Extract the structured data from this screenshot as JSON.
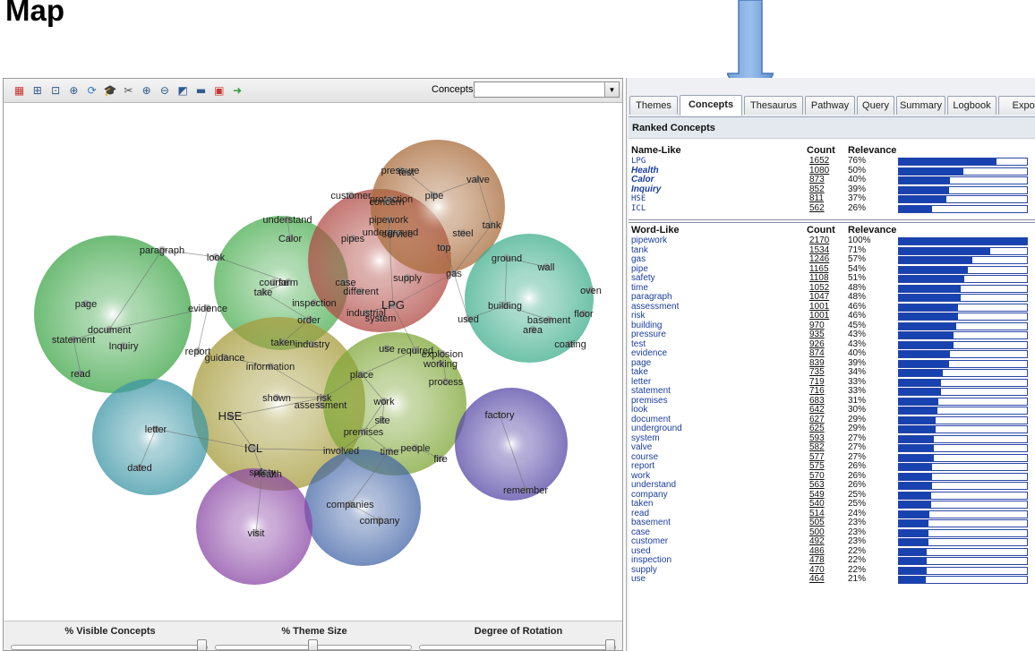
{
  "heading": "Map",
  "toolbar": {
    "icons": [
      "leximancer-logo-icon",
      "fit-icon",
      "center-icon",
      "expand-icon",
      "refresh-icon",
      "graduation-cap-icon",
      "scissors-icon",
      "zoom-in-icon",
      "zoom-out-icon",
      "chart-icon",
      "image-icon",
      "save-icon",
      "go-arrow-icon"
    ],
    "concepts_label": "Concepts:",
    "concepts_value": ""
  },
  "themes": [
    {
      "id": "document",
      "color": "#3fa649"
    },
    {
      "id": "understand",
      "color": "#4cae52"
    },
    {
      "id": "pipework",
      "color": "#b04a44"
    },
    {
      "id": "pressure",
      "color": "#a96b3a"
    },
    {
      "id": "building",
      "color": "#3fae8c"
    },
    {
      "id": "HSE",
      "color": "#a59b3a"
    },
    {
      "id": "letter",
      "color": "#3c96a6"
    },
    {
      "id": "work",
      "color": "#7ea636"
    },
    {
      "id": "factory",
      "color": "#5648a6"
    },
    {
      "id": "companies",
      "color": "#4567a8"
    },
    {
      "id": "visit",
      "color": "#8b48a6"
    }
  ],
  "map_labels": [
    {
      "text": "pressure"
    },
    {
      "text": "test"
    },
    {
      "text": "valve"
    },
    {
      "text": "customer"
    },
    {
      "text": "protection"
    },
    {
      "text": "concern"
    },
    {
      "text": "pipe"
    },
    {
      "text": "understand"
    },
    {
      "text": "pipework"
    },
    {
      "text": "Calor"
    },
    {
      "text": "pipes"
    },
    {
      "text": "underground"
    },
    {
      "text": "service"
    },
    {
      "text": "tank"
    },
    {
      "text": "steel"
    },
    {
      "text": "top"
    },
    {
      "text": "paragraph"
    },
    {
      "text": "look"
    },
    {
      "text": "ground"
    },
    {
      "text": "wall"
    },
    {
      "text": "gas"
    },
    {
      "text": "supply"
    },
    {
      "text": "course"
    },
    {
      "text": "form"
    },
    {
      "text": "case"
    },
    {
      "text": "different"
    },
    {
      "text": "take"
    },
    {
      "text": "oven"
    },
    {
      "text": "page"
    },
    {
      "text": "evidence"
    },
    {
      "text": "inspection"
    },
    {
      "text": "LPG"
    },
    {
      "text": "building"
    },
    {
      "text": "industrial"
    },
    {
      "text": "system"
    },
    {
      "text": "floor"
    },
    {
      "text": "order"
    },
    {
      "text": "used"
    },
    {
      "text": "basement"
    },
    {
      "text": "area"
    },
    {
      "text": "document"
    },
    {
      "text": "statement"
    },
    {
      "text": "Inquiry"
    },
    {
      "text": "taken"
    },
    {
      "text": "industry"
    },
    {
      "text": "coating"
    },
    {
      "text": "report"
    },
    {
      "text": "guidance"
    },
    {
      "text": "use"
    },
    {
      "text": "required"
    },
    {
      "text": "explosion"
    },
    {
      "text": "information"
    },
    {
      "text": "working"
    },
    {
      "text": "read"
    },
    {
      "text": "place"
    },
    {
      "text": "process"
    },
    {
      "text": "risk"
    },
    {
      "text": "shown"
    },
    {
      "text": "assessment"
    },
    {
      "text": "work"
    },
    {
      "text": "HSE"
    },
    {
      "text": "factory"
    },
    {
      "text": "letter"
    },
    {
      "text": "site"
    },
    {
      "text": "premises"
    },
    {
      "text": "ICL"
    },
    {
      "text": "involved"
    },
    {
      "text": "time"
    },
    {
      "text": "people"
    },
    {
      "text": "fire"
    },
    {
      "text": "dated"
    },
    {
      "text": "safety"
    },
    {
      "text": "Health"
    },
    {
      "text": "remember"
    },
    {
      "text": "companies"
    },
    {
      "text": "company"
    },
    {
      "text": "visit"
    }
  ],
  "sliders": [
    {
      "label": "% Visible Concepts",
      "value": 1.0
    },
    {
      "label": "% Theme Size",
      "value": 0.5
    },
    {
      "label": "Degree of Rotation",
      "value": 1.0
    }
  ],
  "tabs": [
    {
      "label": "Themes",
      "active": false
    },
    {
      "label": "Concepts",
      "active": true
    },
    {
      "label": "Thesaurus",
      "active": false
    },
    {
      "label": "Pathway",
      "active": false
    },
    {
      "label": "Query",
      "active": false
    },
    {
      "label": "Summary",
      "active": false
    },
    {
      "label": "Logbook",
      "active": false
    },
    {
      "label": "Expor",
      "active": false
    }
  ],
  "ranked_title": "Ranked Concepts",
  "name_like": {
    "header": "Name-Like",
    "count_header": "Count",
    "relevance_header": "Relevance",
    "rows": [
      {
        "name": "LPG",
        "count": "1652",
        "pct": "76%",
        "value": 0.76,
        "style": "mono"
      },
      {
        "name": "Health",
        "count": "1080",
        "pct": "50%",
        "value": 0.5,
        "style": "bi"
      },
      {
        "name": "Calor",
        "count": "873",
        "pct": "40%",
        "value": 0.4,
        "style": "bi"
      },
      {
        "name": "Inquiry",
        "count": "852",
        "pct": "39%",
        "value": 0.39,
        "style": "bi"
      },
      {
        "name": "HSE",
        "count": "811",
        "pct": "37%",
        "value": 0.37,
        "style": "mono"
      },
      {
        "name": "ICL",
        "count": "562",
        "pct": "26%",
        "value": 0.26,
        "style": "mono"
      }
    ]
  },
  "word_like": {
    "header": "Word-Like",
    "count_header": "Count",
    "relevance_header": "Relevance",
    "rows": [
      {
        "name": "pipework",
        "count": "2170",
        "pct": "100%",
        "value": 1.0
      },
      {
        "name": "tank",
        "count": "1534",
        "pct": "71%",
        "value": 0.71
      },
      {
        "name": "gas",
        "count": "1246",
        "pct": "57%",
        "value": 0.57
      },
      {
        "name": "pipe",
        "count": "1165",
        "pct": "54%",
        "value": 0.54
      },
      {
        "name": "safety",
        "count": "1108",
        "pct": "51%",
        "value": 0.51
      },
      {
        "name": "time",
        "count": "1052",
        "pct": "48%",
        "value": 0.48
      },
      {
        "name": "paragraph",
        "count": "1047",
        "pct": "48%",
        "value": 0.48
      },
      {
        "name": "assessment",
        "count": "1001",
        "pct": "46%",
        "value": 0.46
      },
      {
        "name": "risk",
        "count": "1001",
        "pct": "46%",
        "value": 0.46
      },
      {
        "name": "building",
        "count": "970",
        "pct": "45%",
        "value": 0.45
      },
      {
        "name": "pressure",
        "count": "935",
        "pct": "43%",
        "value": 0.43
      },
      {
        "name": "test",
        "count": "926",
        "pct": "43%",
        "value": 0.43
      },
      {
        "name": "evidence",
        "count": "874",
        "pct": "40%",
        "value": 0.4
      },
      {
        "name": "page",
        "count": "839",
        "pct": "39%",
        "value": 0.39
      },
      {
        "name": "take",
        "count": "735",
        "pct": "34%",
        "value": 0.34
      },
      {
        "name": "letter",
        "count": "719",
        "pct": "33%",
        "value": 0.33
      },
      {
        "name": "statement",
        "count": "716",
        "pct": "33%",
        "value": 0.33
      },
      {
        "name": "premises",
        "count": "683",
        "pct": "31%",
        "value": 0.31
      },
      {
        "name": "look",
        "count": "642",
        "pct": "30%",
        "value": 0.3
      },
      {
        "name": "document",
        "count": "627",
        "pct": "29%",
        "value": 0.29
      },
      {
        "name": "underground",
        "count": "625",
        "pct": "29%",
        "value": 0.29
      },
      {
        "name": "system",
        "count": "593",
        "pct": "27%",
        "value": 0.27
      },
      {
        "name": "valve",
        "count": "582",
        "pct": "27%",
        "value": 0.27
      },
      {
        "name": "course",
        "count": "577",
        "pct": "27%",
        "value": 0.27
      },
      {
        "name": "report",
        "count": "575",
        "pct": "26%",
        "value": 0.26
      },
      {
        "name": "work",
        "count": "570",
        "pct": "26%",
        "value": 0.26
      },
      {
        "name": "understand",
        "count": "563",
        "pct": "26%",
        "value": 0.26
      },
      {
        "name": "company",
        "count": "549",
        "pct": "25%",
        "value": 0.25
      },
      {
        "name": "taken",
        "count": "540",
        "pct": "25%",
        "value": 0.25
      },
      {
        "name": "read",
        "count": "514",
        "pct": "24%",
        "value": 0.24
      },
      {
        "name": "basement",
        "count": "505",
        "pct": "23%",
        "value": 0.23
      },
      {
        "name": "case",
        "count": "500",
        "pct": "23%",
        "value": 0.23
      },
      {
        "name": "customer",
        "count": "492",
        "pct": "23%",
        "value": 0.23
      },
      {
        "name": "used",
        "count": "486",
        "pct": "22%",
        "value": 0.22
      },
      {
        "name": "inspection",
        "count": "478",
        "pct": "22%",
        "value": 0.22
      },
      {
        "name": "supply",
        "count": "470",
        "pct": "22%",
        "value": 0.22
      },
      {
        "name": "use",
        "count": "464",
        "pct": "21%",
        "value": 0.21
      }
    ]
  }
}
